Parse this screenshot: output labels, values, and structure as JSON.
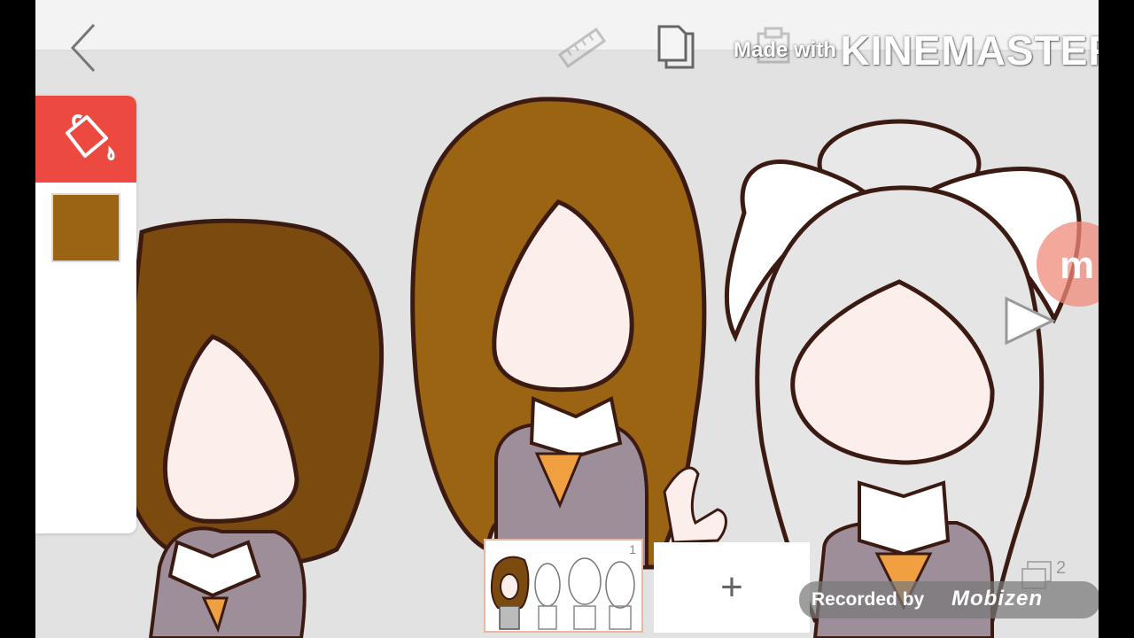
{
  "toolbar": {
    "icons": [
      "back-arrow-icon",
      "ruler-icon",
      "copy-icon",
      "paste-icon"
    ]
  },
  "watermark": {
    "made_with": "Made with",
    "brand": "KINEMASTER"
  },
  "palette": {
    "tool_icon": "paint-bucket-icon",
    "selected_color": "#9a6412",
    "tool_color": "#ec4a40"
  },
  "timeline": {
    "frame_number": "1",
    "add_label": "+"
  },
  "layers": {
    "count": "2"
  },
  "recording": {
    "label": "Recorded by",
    "brand": "Mobizen"
  },
  "colors": {
    "hair_dark": "#7a4a0e",
    "hair_light": "#9a6412",
    "skin": "#fceeea",
    "outline": "#3b1a12",
    "uniform": "#9e8e9a",
    "tie": "#f0a040",
    "accent_red": "#ec4a40"
  }
}
